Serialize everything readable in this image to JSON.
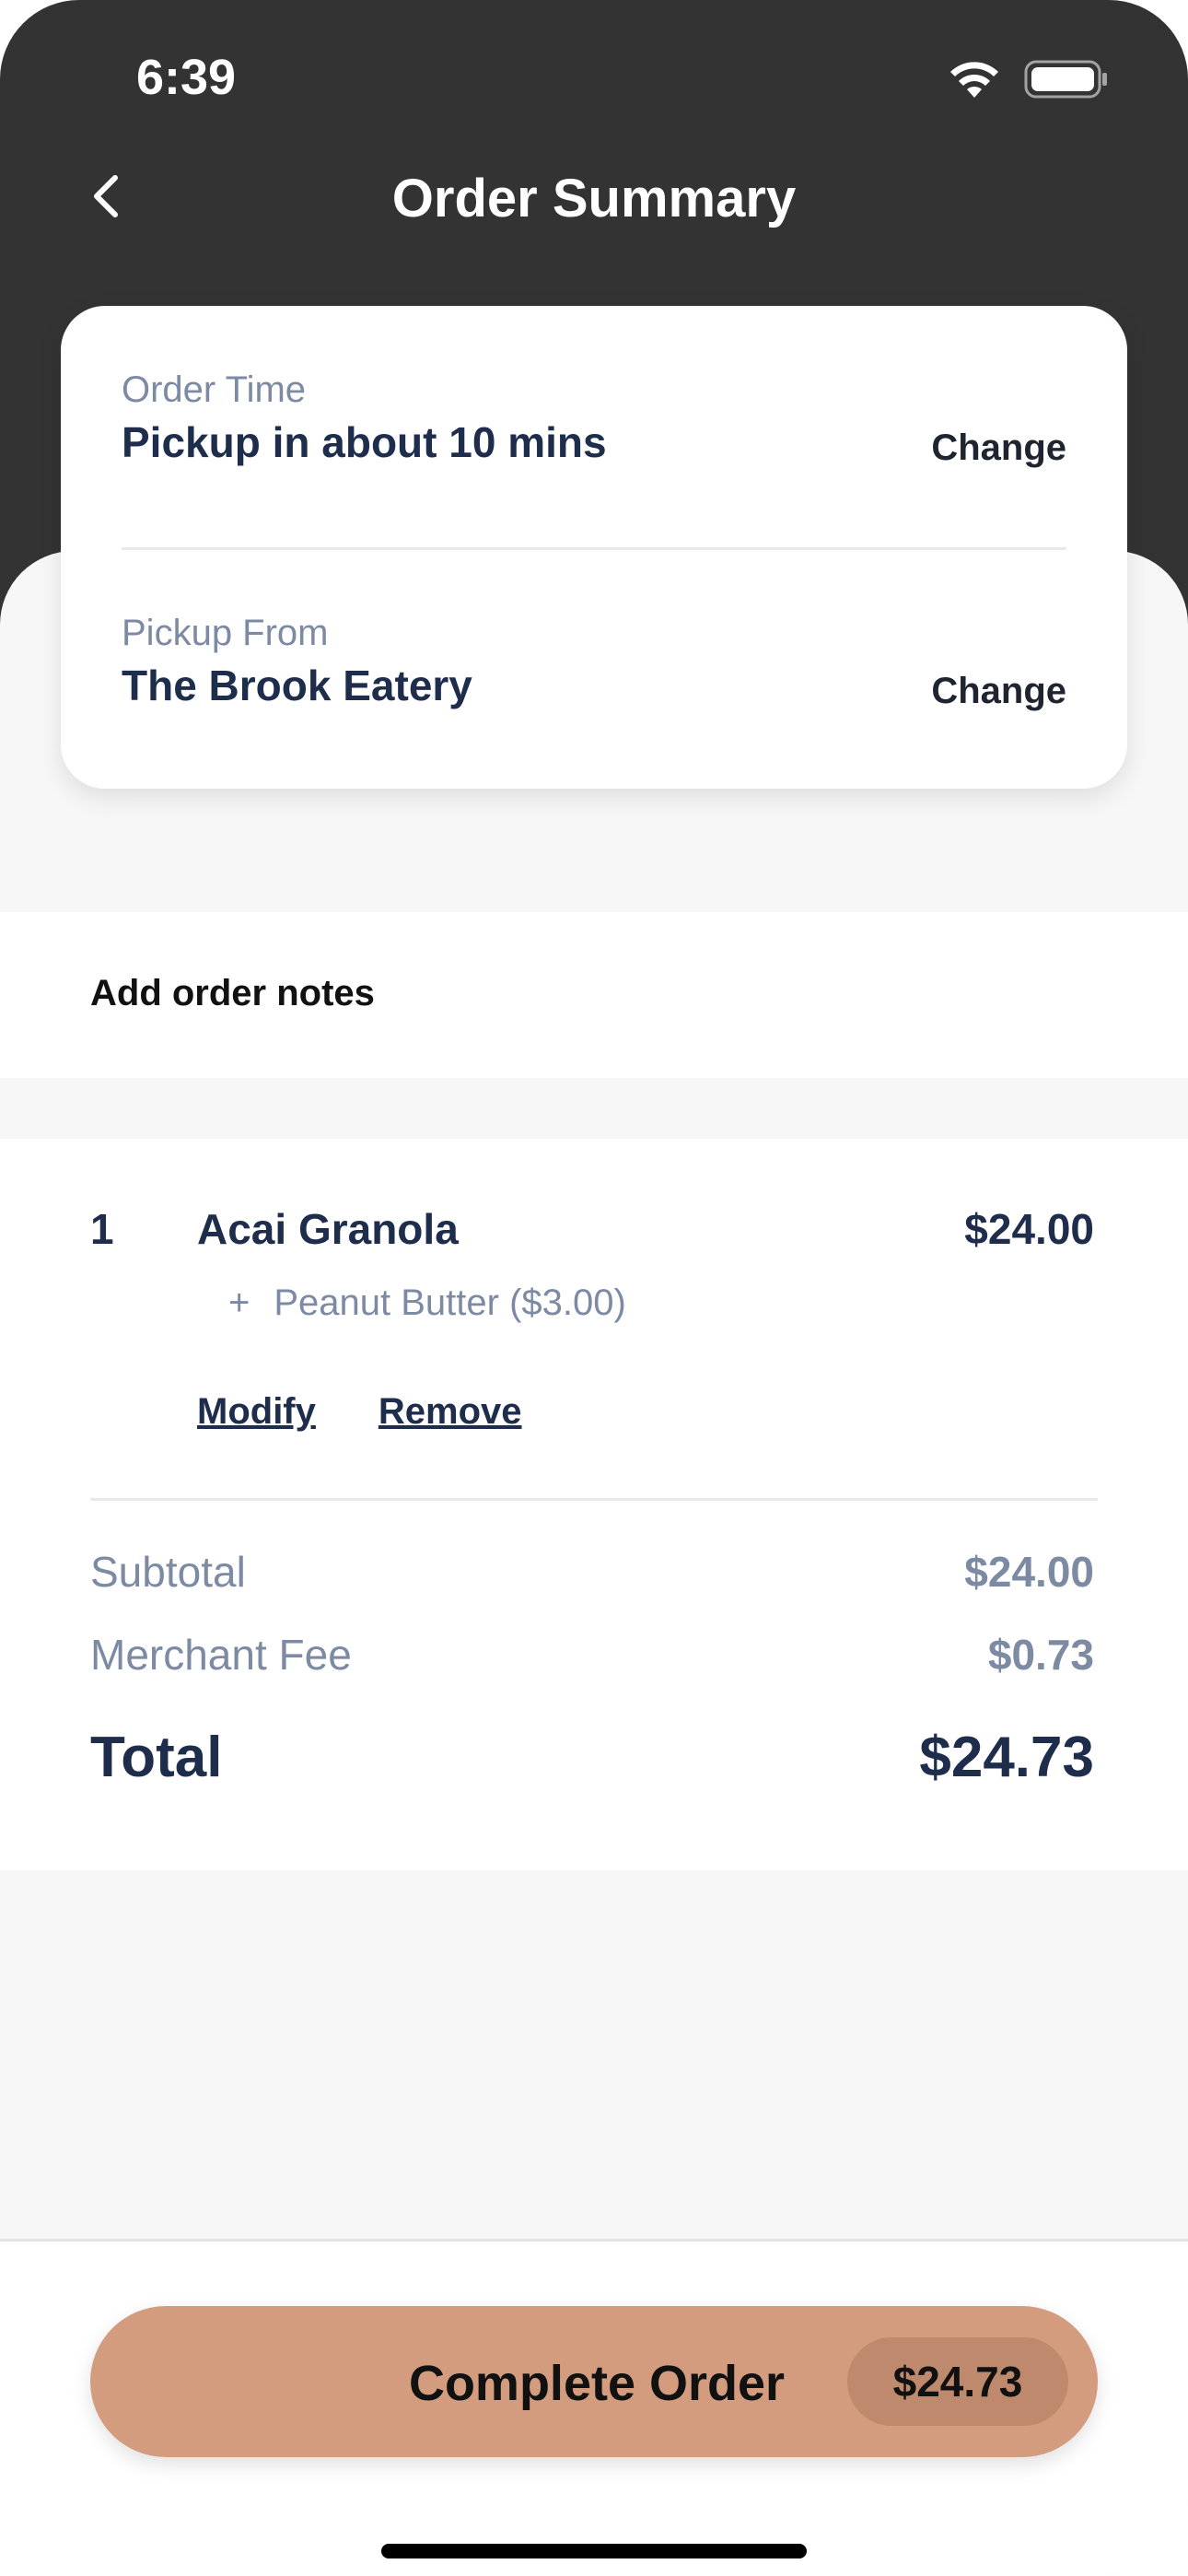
{
  "status_bar": {
    "time": "6:39",
    "icons": [
      "wifi-icon",
      "battery-icon"
    ]
  },
  "header": {
    "title": "Order Summary",
    "back_icon": "chevron-left-icon"
  },
  "order_info": {
    "order_time_label": "Order Time",
    "order_time_value": "Pickup in about 10 mins",
    "order_time_action": "Change",
    "pickup_label": "Pickup From",
    "pickup_value": "The Brook Eatery",
    "pickup_action": "Change"
  },
  "notes": {
    "label": "Add order notes"
  },
  "items": [
    {
      "qty": "1",
      "name": "Acai Granola",
      "price": "$24.00",
      "modifier_prefix": "+",
      "modifier": "Peanut Butter ($3.00)",
      "modify_label": "Modify",
      "remove_label": "Remove"
    }
  ],
  "summary": {
    "subtotal_label": "Subtotal",
    "subtotal_value": "$24.00",
    "fee_label": "Merchant Fee",
    "fee_value": "$0.73",
    "total_label": "Total",
    "total_value": "$24.73"
  },
  "footer": {
    "button_label": "Complete Order",
    "button_price": "$24.73"
  },
  "colors": {
    "header_bg": "#333333",
    "accent": "#d49c7e",
    "accent_dark": "#bf896e",
    "text_primary": "#1f2d4d",
    "text_muted": "#7d8aa3"
  }
}
